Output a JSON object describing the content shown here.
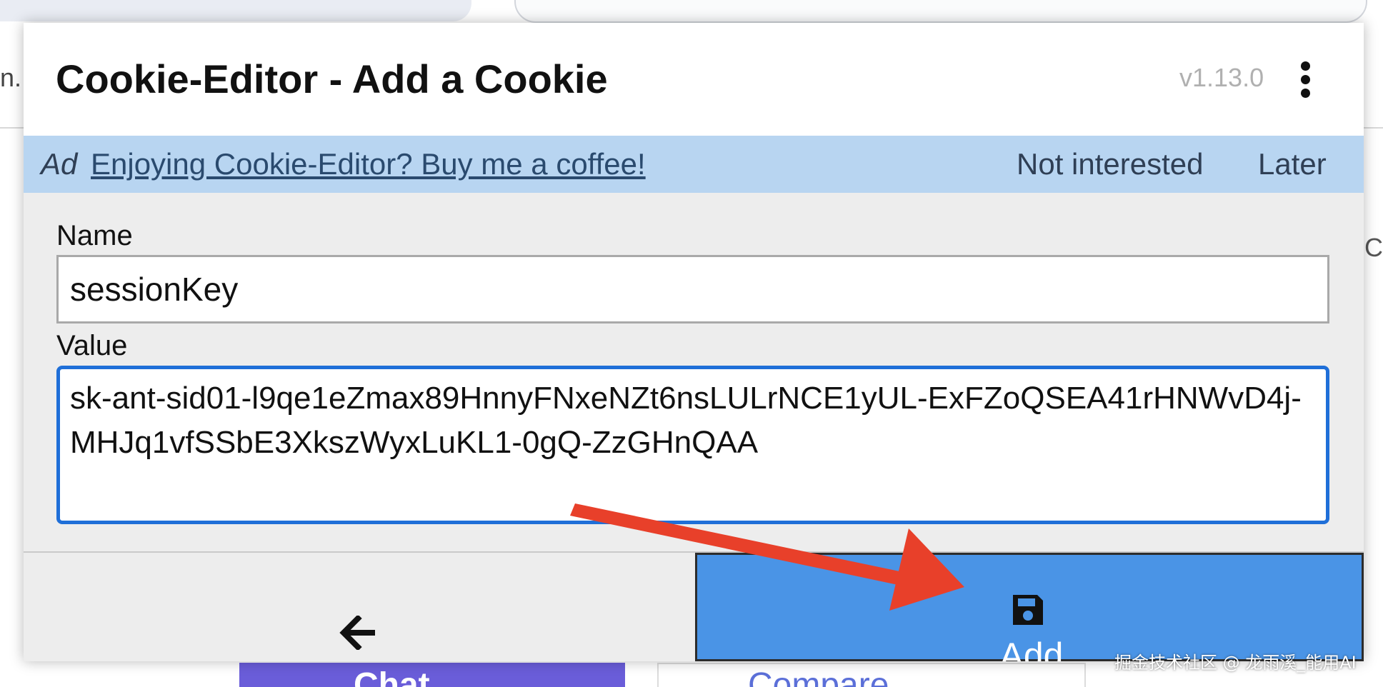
{
  "popup": {
    "title": "Cookie-Editor - Add a Cookie",
    "version": "v1.13.0",
    "menu_icon": "vertical-ellipsis-icon"
  },
  "ad_bar": {
    "label": "Ad",
    "link_text": "Enjoying Cookie-Editor? Buy me a coffee!",
    "not_interested": "Not interested",
    "later": "Later",
    "background": "#b8d5f1"
  },
  "form": {
    "name_label": "Name",
    "name_value": "sessionKey",
    "value_label": "Value",
    "value_value": "sk-ant-sid01-l9qe1eZmax89HnnyFNxeNZt6nsLULrNCE1yUL-ExFZoQSEA41rHNWvD4j-MHJq1vfSSbE3XkszWyxLuKL1-0gQ-ZzGHnQAA",
    "focus_color": "#1f6fd8"
  },
  "footer": {
    "back_icon": "arrow-left-icon",
    "add_icon": "floppy-disk-icon",
    "add_label": "Add",
    "add_color": "#4a94e6"
  },
  "background_page": {
    "left_fragment": "n.",
    "right_fragment": "C",
    "chat_button": "Chat",
    "compare_button": "Compare"
  },
  "annotation": {
    "arrow_color": "#e8402a"
  },
  "watermark": "掘金技术社区 @ 龙雨溪_能用AI"
}
